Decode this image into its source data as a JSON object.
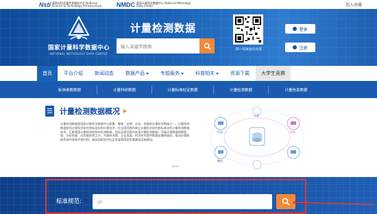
{
  "topbar": {
    "nsti_logo": "Nsti",
    "nsti_text": "国家科技资源共享服务平台 National Science & Technology Infrastructure",
    "nmdc_logo": "NMDC",
    "nmdc_text": "国家计量科学数据中心 National Metrology Data Center",
    "favorite": "加入收藏"
  },
  "banner": {
    "brand_cn": "国家计量科学数据中心",
    "brand_en": "NATIONAL METROLOGY DATA CENTER",
    "title": "计量检测数据",
    "search_placeholder": "输入关键字搜索",
    "qr_caption": "扫一扫关注公众号",
    "login": "登录",
    "register": "注册"
  },
  "nav": {
    "items": [
      {
        "label": "首页",
        "active": true,
        "dropdown": false
      },
      {
        "label": "平台介绍",
        "active": false,
        "dropdown": false
      },
      {
        "label": "新闻动态",
        "active": false,
        "dropdown": false
      },
      {
        "label": "数据产品",
        "active": false,
        "dropdown": true
      },
      {
        "label": "专题服务",
        "active": false,
        "dropdown": true
      },
      {
        "label": "科普相关",
        "active": false,
        "dropdown": true
      },
      {
        "label": "资源下载",
        "active": false,
        "dropdown": false
      },
      {
        "label": "大学生竞赛",
        "active": false,
        "dropdown": false
      }
    ]
  },
  "subnav": {
    "items": [
      "标准参数数据",
      "计量科研数据",
      "计量标准检定数据",
      "计量检测数据",
      "计量信息数据"
    ]
  },
  "overview": {
    "title": "计量检测数据概况",
    "paragraph": "计量检测数据是国家计量科学数据中心收集、整理、存储、分析、挖掘的计量科学数据之一。计量检测数据依托计量科学研究和标准化和计量技术、在全国范围内建立计量科学研究和标准化的计量检测数据体系，汇集我国计量检测机构的检测数据，包括全国范围内各类计量检测数据，开展计量数据质量管理、分析挖掘、应用服务等工作，为政府决策、企业发展、科学研究提供数据支撑和服务，推动计量数据资源共享和开放利用，服务国家经济社会发展和国家质量基础设施建设。",
    "more": "more"
  },
  "graphic": {
    "nodes": [
      "检测",
      "计量",
      "分析",
      "整理"
    ]
  },
  "std_search": {
    "label": "标准规范:",
    "value": "gb"
  },
  "colors": {
    "primary": "#1a62b5",
    "accent": "#f08a3a",
    "highlight_box": "#e53935"
  }
}
